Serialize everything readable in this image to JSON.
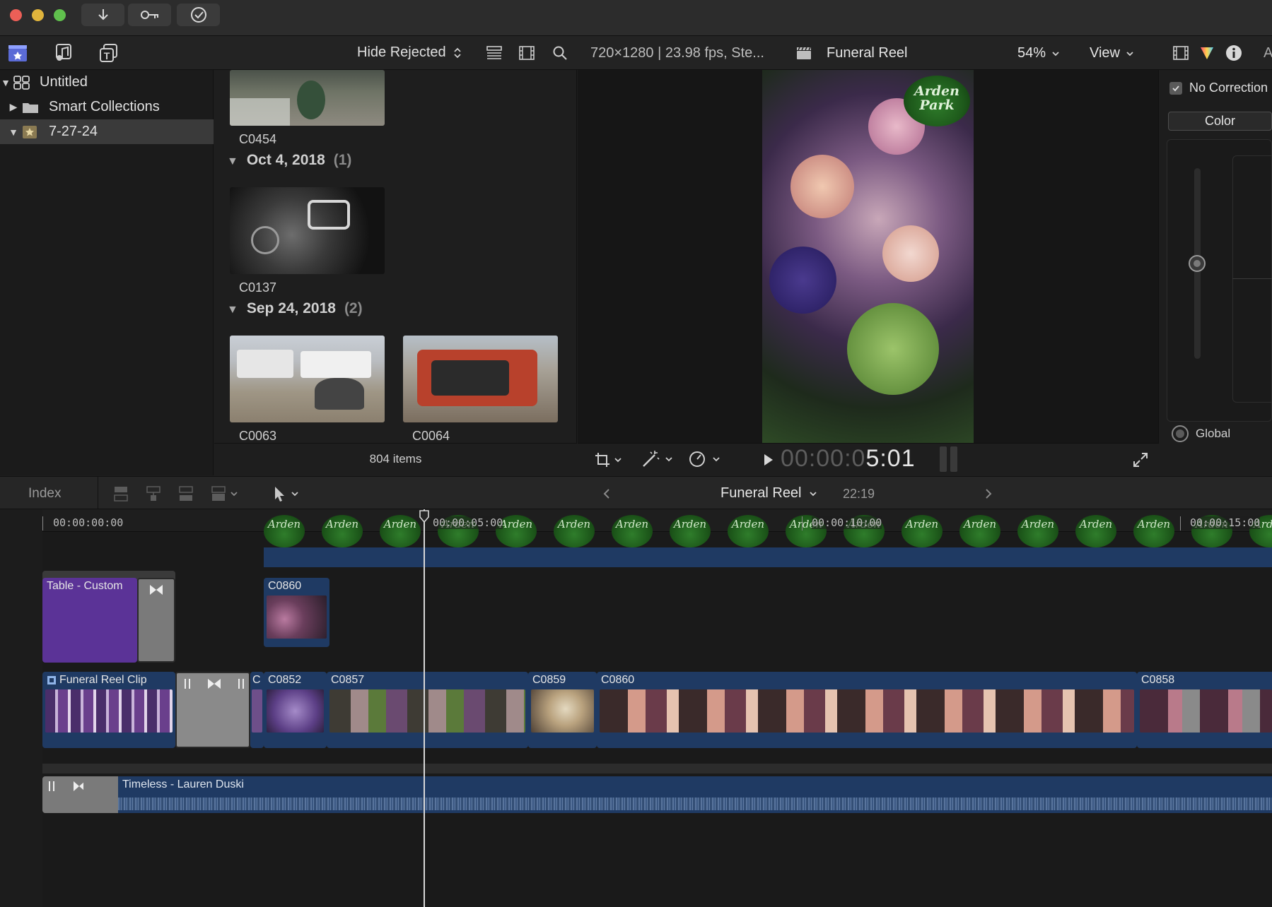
{
  "titlebar": {
    "traffic_colors": [
      "#ec5f57",
      "#e0b43c",
      "#60c04d"
    ],
    "buttons": [
      "download-icon",
      "key-icon",
      "checkmark-icon"
    ]
  },
  "toolbar": {
    "filter_label": "Hide Rejected",
    "viewer_info": "720×1280 | 23.98 fps, Ste...",
    "project_name": "Funeral Reel",
    "zoom": "54%",
    "view_label": "View",
    "inspector_tab_label": "A"
  },
  "sidebar": {
    "library": "Untitled",
    "items": [
      {
        "label": "Smart Collections"
      },
      {
        "label": "7-27-24"
      }
    ]
  },
  "browser": {
    "top_clip": "C0454",
    "groups": [
      {
        "date": "Oct 4, 2018",
        "count": "(1)",
        "clips": [
          "C0137"
        ]
      },
      {
        "date": "Sep 24, 2018",
        "count": "(2)",
        "clips": [
          "C0063",
          "C0064"
        ]
      }
    ],
    "item_count": "804 items"
  },
  "viewer": {
    "logo_text_1": "Arden",
    "logo_text_2": "Park",
    "timecode_dim": "00:00:0",
    "timecode": "5:01"
  },
  "inspector": {
    "no_correction": "No Correction",
    "color_label": "Color",
    "global_label": "Global"
  },
  "timeline_header": {
    "index_label": "Index",
    "project_name": "Funeral Reel",
    "duration": "22:19"
  },
  "timeline": {
    "ruler": [
      "00:00:00:00",
      "00:00:05:00",
      "00:00:10:00",
      "00:00:15:00"
    ],
    "title_clip": "Table  - Custom",
    "connected_clip": "C0860",
    "primary_clips": [
      "Funeral Reel Clip",
      "C",
      "C0852",
      "C0857",
      "C0859",
      "C0860",
      "C0858"
    ],
    "audio_clip": "Timeless - Lauren Duski"
  }
}
